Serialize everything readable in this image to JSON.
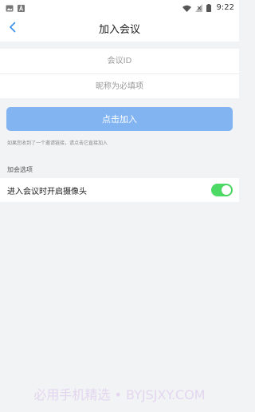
{
  "status_bar": {
    "time": "9:22",
    "left_icons": [
      "image-icon",
      "app-a-icon"
    ],
    "right_icons": [
      "wifi-icon",
      "signal-off-icon",
      "battery-icon"
    ]
  },
  "nav": {
    "back_icon": "chevron-left-icon",
    "title": "加入会议"
  },
  "form": {
    "meeting_id_placeholder": "会议ID",
    "meeting_id_value": "",
    "nickname_placeholder": "昵称为必填项",
    "nickname_value": ""
  },
  "join_button": {
    "label": "点击加入",
    "color": "#82b4f2"
  },
  "hint": "如果您收到了一个邀请链接，请点击它直接加入",
  "options": {
    "section_title": "加会选项",
    "camera": {
      "label": "进入会议时开启摄像头",
      "enabled": true,
      "toggle_color": "#4cd964"
    }
  },
  "watermark": "必用手机精选 • BYJSJXY.COM"
}
